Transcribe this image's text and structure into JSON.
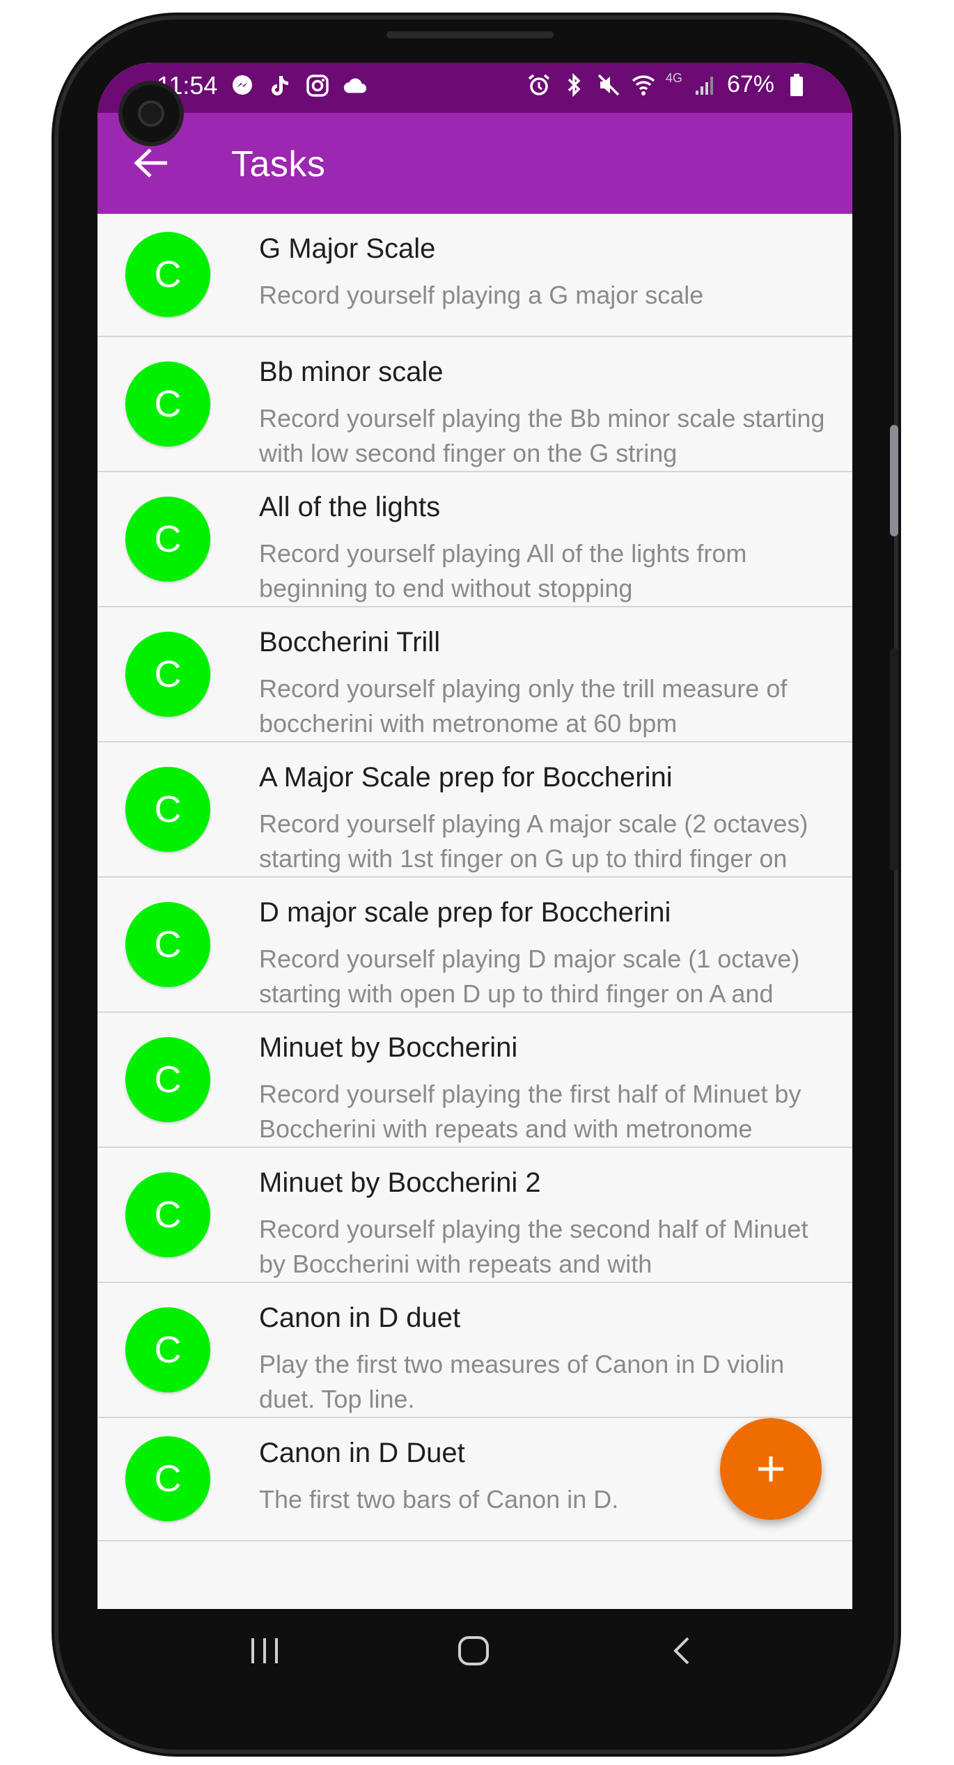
{
  "status_bar": {
    "time": "11:54",
    "battery": "67%",
    "network": "4G",
    "left_icons": [
      "messenger-icon",
      "tiktok-icon",
      "instagram-icon",
      "cloud-icon"
    ],
    "right_icons": [
      "alarm-icon",
      "bluetooth-icon",
      "mute-icon",
      "wifi-icon",
      "signal-icon",
      "battery-icon"
    ]
  },
  "app_bar": {
    "title": "Tasks",
    "back_icon": "arrow-back-icon"
  },
  "tasks": [
    {
      "avatar": "C",
      "title": "G Major Scale",
      "description": "Record yourself playing a G major scale"
    },
    {
      "avatar": "C",
      "title": "Bb minor scale",
      "description": "Record yourself playing the Bb minor scale starting with low second finger on the G string"
    },
    {
      "avatar": "C",
      "title": "All of the lights",
      "description": "Record yourself playing All of the lights from beginning to end without stopping"
    },
    {
      "avatar": "C",
      "title": "Boccherini Trill",
      "description": "Record yourself playing only the trill measure of boccherini with metronome at 60 bpm"
    },
    {
      "avatar": "C",
      "title": "A Major Scale prep for Boccherini",
      "description": "Record yourself playing A major scale (2 octaves) starting with 1st finger on G up to third finger on"
    },
    {
      "avatar": "C",
      "title": "D major scale prep for Boccherini",
      "description": "Record yourself playing D major scale (1 octave) starting with open D up to third finger on A and"
    },
    {
      "avatar": "C",
      "title": "Minuet by Boccherini",
      "description": "Record yourself playing the first half of Minuet by Boccherini with repeats and with metronome"
    },
    {
      "avatar": "C",
      "title": "Minuet by Boccherini 2",
      "description": "Record yourself playing the second half of Minuet by Boccherini with repeats and with"
    },
    {
      "avatar": "C",
      "title": "Canon in D duet",
      "description": "Play the first two measures of Canon in D violin duet. Top line."
    },
    {
      "avatar": "C",
      "title": "Canon in D Duet",
      "description": "The first two bars of Canon in D."
    }
  ],
  "fab": {
    "icon": "add-icon"
  },
  "nav_bar": {
    "icons": [
      "recent-apps-icon",
      "home-icon",
      "back-icon"
    ]
  },
  "colors": {
    "status_bar": "#6c0b73",
    "app_bar": "#9c27b0",
    "avatar": "#00f000",
    "fab": "#ef6c00",
    "list_bg": "#f7f7f7"
  }
}
